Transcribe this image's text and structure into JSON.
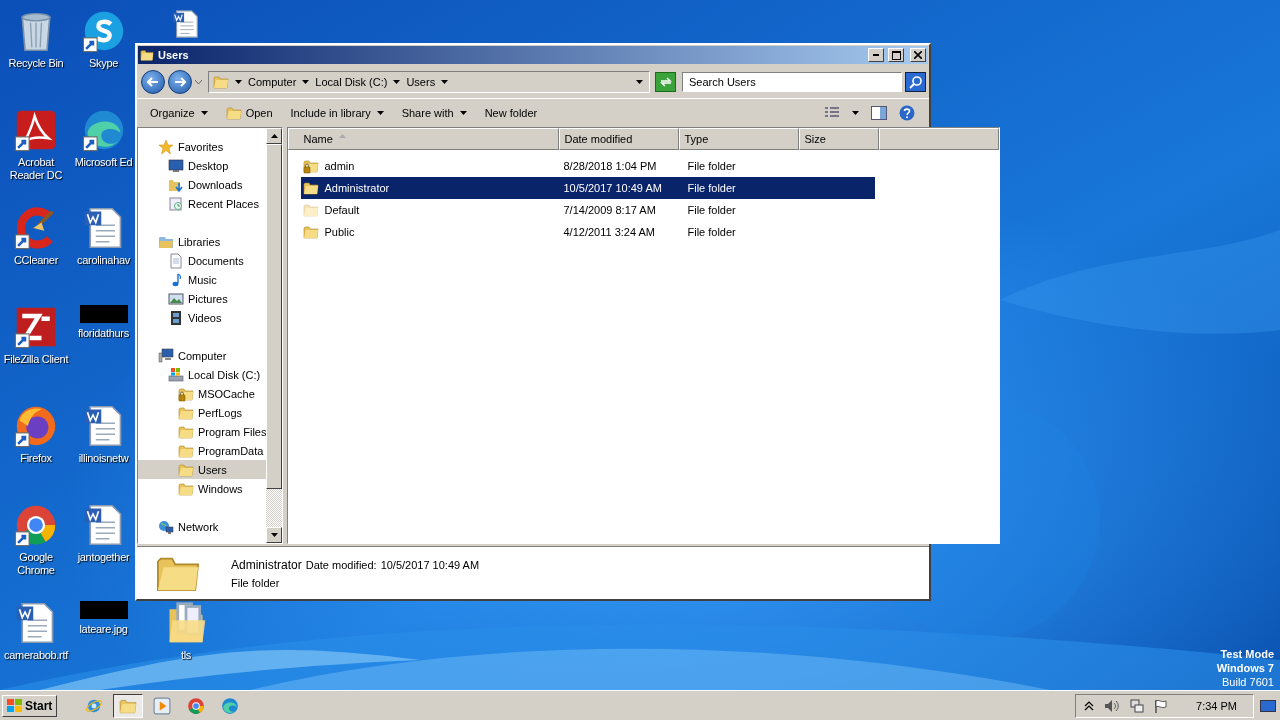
{
  "desktop_columns": [
    [
      {
        "kind": "bin",
        "label": "Recycle Bin",
        "shortcut": false
      },
      {
        "kind": "acrobat",
        "label": "Acrobat Reader DC",
        "shortcut": true
      },
      {
        "kind": "ccleaner",
        "label": "CCleaner",
        "shortcut": true
      },
      {
        "kind": "filezilla",
        "label": "FileZilla Client",
        "shortcut": true
      },
      {
        "kind": "firefox",
        "label": "Firefox",
        "shortcut": true
      },
      {
        "kind": "chrome",
        "label": "Google Chrome",
        "shortcut": true
      },
      {
        "kind": "document",
        "label": "camerabob.rtf",
        "shortcut": false
      }
    ],
    [
      {
        "kind": "skype",
        "label": "Skype",
        "shortcut": true
      },
      {
        "kind": "edge",
        "label": "Microsoft Ed",
        "shortcut": true
      },
      {
        "kind": "document",
        "label": "carolinahav",
        "shortcut": false
      },
      {
        "label": "floridathurs",
        "shortcut": false
      },
      {
        "kind": "document",
        "label": "illinoisnetw",
        "shortcut": false
      },
      {
        "kind": "document",
        "label": "jantogether",
        "shortcut": false
      },
      {
        "label": "lateare.jpg",
        "shortcut": false
      }
    ],
    [
      {
        "kind": "document",
        "shortcut": false
      },
      {
        "kind": "bundle",
        "label": "tls",
        "shortcut": false
      }
    ]
  ],
  "window": {
    "title": "Users"
  },
  "address": {
    "segments": [
      "Computer",
      "Local Disk (C:)",
      "Users"
    ]
  },
  "search": {
    "placeholder": "Search Users"
  },
  "toolbar": [
    {
      "label": "Organize",
      "dropdown": true,
      "icon": false
    },
    {
      "label": "Open",
      "dropdown": false,
      "icon": true
    },
    {
      "label": "Include in library",
      "dropdown": true,
      "icon": false
    },
    {
      "label": "Share with",
      "dropdown": true,
      "icon": false
    },
    {
      "label": "New folder",
      "dropdown": false,
      "icon": false
    }
  ],
  "nav_tree": [
    {
      "label": "Favorites",
      "selected": false,
      "children": [
        {
          "label": "Desktop",
          "selected": false
        },
        {
          "label": "Downloads",
          "selected": false
        },
        {
          "label": "Recent Places",
          "selected": false
        }
      ]
    },
    {
      "label": "Libraries",
      "selected": false,
      "children": [
        {
          "label": "Documents",
          "selected": false
        },
        {
          "label": "Music",
          "selected": false
        },
        {
          "label": "Pictures",
          "selected": false
        },
        {
          "label": "Videos",
          "selected": false
        }
      ]
    },
    {
      "label": "Computer",
      "selected": false,
      "children": [
        {
          "label": "Local Disk (C:)",
          "selected": false,
          "children": [
            {
              "label": "MSOCache",
              "selected": false,
              "locked": true
            },
            {
              "label": "PerfLogs",
              "selected": false,
              "locked": false
            },
            {
              "label": "Program Files",
              "selected": false,
              "locked": false
            },
            {
              "label": "ProgramData",
              "selected": false,
              "locked": false
            },
            {
              "label": "Users",
              "selected": true,
              "locked": false
            },
            {
              "label": "Windows",
              "selected": false,
              "locked": false
            }
          ]
        }
      ]
    },
    {
      "label": "Network",
      "selected": false
    }
  ],
  "columns": [
    {
      "label": "Name",
      "sorted": true
    },
    {
      "label": "Date modified",
      "sorted": false
    },
    {
      "label": "Type",
      "sorted": false
    },
    {
      "label": "Size",
      "sorted": false
    }
  ],
  "rows": [
    {
      "name": "admin",
      "date": "8/28/2018 1:04 PM",
      "type": "File folder",
      "selected": false,
      "locked": true,
      "hidden": false
    },
    {
      "name": "Administrator",
      "date": "10/5/2017 10:49 AM",
      "type": "File folder",
      "selected": true,
      "locked": false,
      "hidden": false
    },
    {
      "name": "Default",
      "date": "7/14/2009 8:17 AM",
      "type": "File folder",
      "selected": false,
      "locked": false,
      "hidden": true
    },
    {
      "name": "Public",
      "date": "4/12/2011 3:24 AM",
      "type": "File folder",
      "selected": false,
      "locked": false,
      "hidden": false
    }
  ],
  "details": {
    "name": "Administrator",
    "date_label": "Date modified:",
    "date": "10/5/2017 10:49 AM",
    "type": "File folder"
  },
  "os_notice": [
    "Test Mode",
    "Windows 7",
    "Build 7601"
  ],
  "taskbar": {
    "start": "Start",
    "pinned": [
      {
        "kind": "ie",
        "selected": false
      },
      {
        "kind": "explorer",
        "selected": true
      },
      {
        "kind": "media",
        "selected": false
      },
      {
        "kind": "chrome",
        "selected": false
      },
      {
        "kind": "edge",
        "selected": false
      }
    ],
    "clock": "7:34 PM"
  }
}
